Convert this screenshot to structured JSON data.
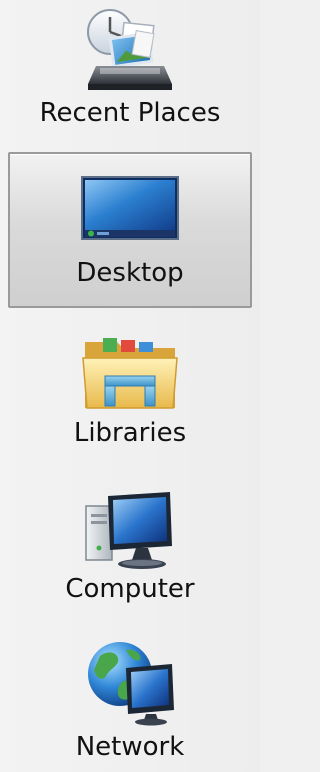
{
  "places": [
    {
      "id": "recent-places",
      "label": "Recent Places",
      "icon": "recent-places-icon",
      "selected": false
    },
    {
      "id": "desktop",
      "label": "Desktop",
      "icon": "desktop-icon",
      "selected": true
    },
    {
      "id": "libraries",
      "label": "Libraries",
      "icon": "libraries-icon",
      "selected": false
    },
    {
      "id": "computer",
      "label": "Computer",
      "icon": "computer-icon",
      "selected": false
    },
    {
      "id": "network",
      "label": "Network",
      "icon": "network-icon",
      "selected": false
    }
  ],
  "colors": {
    "selected_border": "#9a9a9a",
    "selected_fill": "#d8d8d8",
    "background": "#f0f0f0"
  }
}
